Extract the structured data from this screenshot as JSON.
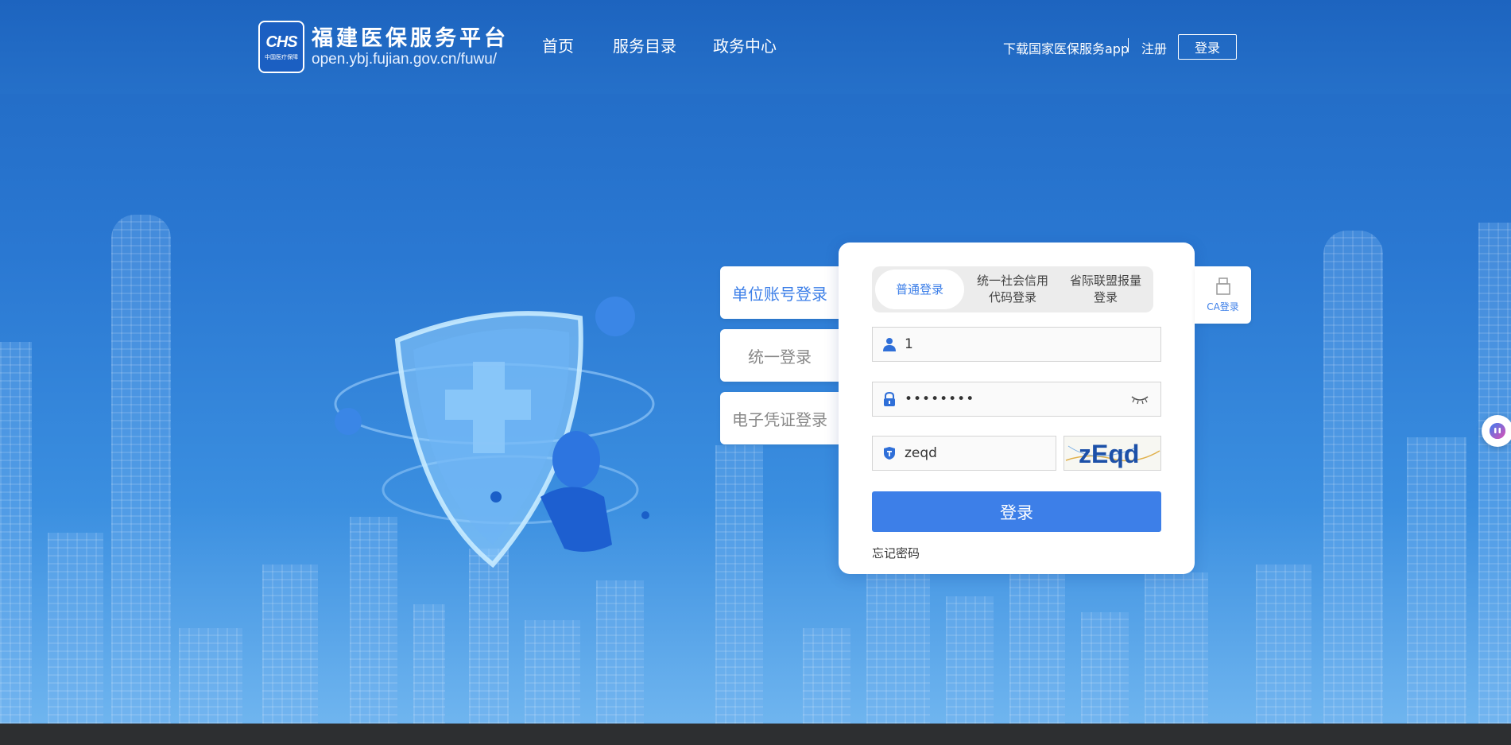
{
  "header": {
    "logo_text": "CHS",
    "logo_sub": "中国医疗保障",
    "title": "福建医保服务平台",
    "url": "open.ybj.fujian.gov.cn/fuwu/",
    "nav": [
      "首页",
      "服务目录",
      "政务中心"
    ],
    "download_app": "下载国家医保服务app",
    "register": "注册",
    "login": "登录"
  },
  "side_tabs": [
    "单位账号登录",
    "统一登录",
    "电子凭证登录"
  ],
  "login_form": {
    "modes": [
      {
        "line1": "普通登录",
        "line2": ""
      },
      {
        "line1": "统一社会信用",
        "line2": "代码登录"
      },
      {
        "line1": "省际联盟报量",
        "line2": "登录"
      }
    ],
    "username_value": "1",
    "password_value": "••••••••",
    "captcha_value": "zeqd",
    "captcha_image_text": "zEqd",
    "submit_label": "登录",
    "forgot_label": "忘记密码"
  },
  "ca_login": {
    "label": "CA登录"
  },
  "colors": {
    "accent": "#3d7fe8",
    "header_bg": "#1d64bf"
  },
  "icons": [
    "user-icon",
    "lock-icon",
    "eye-closed-icon",
    "shield-icon",
    "usb-key-icon",
    "assistant-icon"
  ]
}
